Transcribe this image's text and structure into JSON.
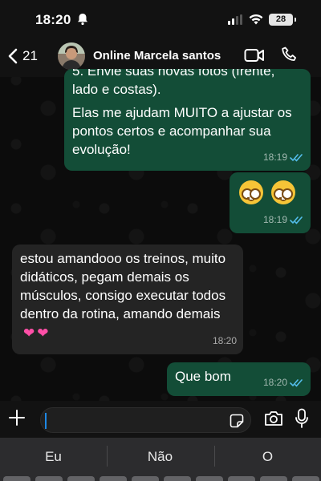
{
  "status_bar": {
    "time": "18:20",
    "battery": "28"
  },
  "header": {
    "back_count": "21",
    "contact_name": "Online Marcela santos"
  },
  "messages": [
    {
      "direction": "out",
      "cut_text": "5. Envie suas novas fotos (frente,\nlado e costas).",
      "text": "Elas me ajudam MUITO a ajustar os pontos certos e acompanhar sua evolução!",
      "time": "18:19",
      "read": true
    },
    {
      "direction": "out",
      "emoji": [
        "nerd-face",
        "nerd-face"
      ],
      "time": "18:19",
      "read": true
    },
    {
      "direction": "in",
      "text": "estou amandooo os treinos, muito didáticos, pegam demais os músculos, consigo executar todos dentro da rotina, amando demais",
      "emoji": [
        "sparkling-heart",
        "sparkling-heart"
      ],
      "time": "18:20"
    },
    {
      "direction": "out",
      "text": "Que bom",
      "time": "18:20",
      "read": true
    }
  ],
  "input": {
    "value": ""
  },
  "keyboard": {
    "suggestions": [
      "Eu",
      "Não",
      "O"
    ]
  },
  "colors": {
    "outgoing_bubble": "#134d37",
    "incoming_bubble": "#242424",
    "read_ticks": "#53bdeb",
    "caret": "#1e88e5"
  }
}
